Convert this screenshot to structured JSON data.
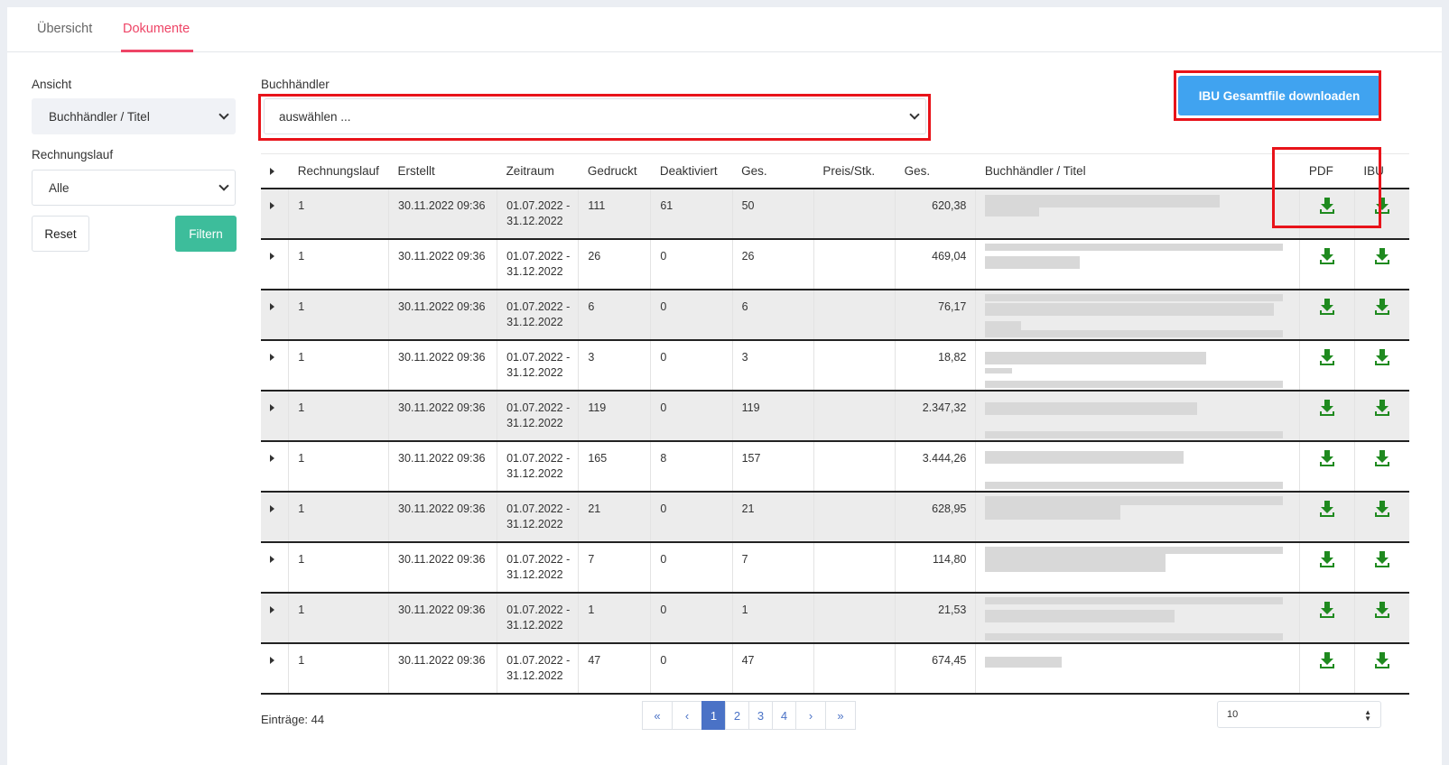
{
  "tabs": [
    {
      "label": "Übersicht"
    },
    {
      "label": "Dokumente"
    }
  ],
  "sidebar": {
    "view_label": "Ansicht",
    "view_value": "Buchhändler / Titel",
    "run_label": "Rechnungslauf",
    "run_value": "Alle",
    "reset_label": "Reset",
    "filter_label": "Filtern"
  },
  "filter": {
    "bookseller_label": "Buchhändler",
    "bookseller_placeholder": "auswählen ..."
  },
  "download_all_label": "IBU Gesamtfile downloaden",
  "table": {
    "headers": [
      "Rechnungslauf",
      "Erstellt",
      "Zeitraum",
      "Gedruckt",
      "Deaktiviert",
      "Ges.",
      "Preis/Stk.",
      "Ges.",
      "Buchhändler / Titel",
      "PDF",
      "IBU"
    ],
    "rows": [
      {
        "run": "1",
        "created": "30.11.2022 09:36",
        "period_from": "01.07.2022 -",
        "period_to": "31.12.2022",
        "printed": "111",
        "deactivated": "61",
        "total": "50",
        "price": "",
        "sum": "620,38"
      },
      {
        "run": "1",
        "created": "30.11.2022 09:36",
        "period_from": "01.07.2022 -",
        "period_to": "31.12.2022",
        "printed": "26",
        "deactivated": "0",
        "total": "26",
        "price": "",
        "sum": "469,04"
      },
      {
        "run": "1",
        "created": "30.11.2022 09:36",
        "period_from": "01.07.2022 -",
        "period_to": "31.12.2022",
        "printed": "6",
        "deactivated": "0",
        "total": "6",
        "price": "",
        "sum": "76,17"
      },
      {
        "run": "1",
        "created": "30.11.2022 09:36",
        "period_from": "01.07.2022 -",
        "period_to": "31.12.2022",
        "printed": "3",
        "deactivated": "0",
        "total": "3",
        "price": "",
        "sum": "18,82"
      },
      {
        "run": "1",
        "created": "30.11.2022 09:36",
        "period_from": "01.07.2022 -",
        "period_to": "31.12.2022",
        "printed": "119",
        "deactivated": "0",
        "total": "119",
        "price": "",
        "sum": "2.347,32"
      },
      {
        "run": "1",
        "created": "30.11.2022 09:36",
        "period_from": "01.07.2022 -",
        "period_to": "31.12.2022",
        "printed": "165",
        "deactivated": "8",
        "total": "157",
        "price": "",
        "sum": "3.444,26"
      },
      {
        "run": "1",
        "created": "30.11.2022 09:36",
        "period_from": "01.07.2022 -",
        "period_to": "31.12.2022",
        "printed": "21",
        "deactivated": "0",
        "total": "21",
        "price": "",
        "sum": "628,95"
      },
      {
        "run": "1",
        "created": "30.11.2022 09:36",
        "period_from": "01.07.2022 -",
        "period_to": "31.12.2022",
        "printed": "7",
        "deactivated": "0",
        "total": "7",
        "price": "",
        "sum": "114,80"
      },
      {
        "run": "1",
        "created": "30.11.2022 09:36",
        "period_from": "01.07.2022 -",
        "period_to": "31.12.2022",
        "printed": "1",
        "deactivated": "0",
        "total": "1",
        "price": "",
        "sum": "21,53"
      },
      {
        "run": "1",
        "created": "30.11.2022 09:36",
        "period_from": "01.07.2022 -",
        "period_to": "31.12.2022",
        "printed": "47",
        "deactivated": "0",
        "total": "47",
        "price": "",
        "sum": "674,45"
      }
    ]
  },
  "entries_label": "Einträge: 44",
  "pagination": {
    "first": "«",
    "prev": "‹",
    "pages": [
      "1",
      "2",
      "3",
      "4"
    ],
    "current": "1",
    "next": "›",
    "last": "»"
  },
  "per_page": "10",
  "icons": {
    "download": "download-tray-icon",
    "expand": "caret-right-icon"
  },
  "colors": {
    "accent": "#ee4466",
    "primary": "#40a3f0",
    "success": "#3dbd9b",
    "download": "#1f8a1f",
    "page_active": "#4a72c6",
    "highlight_box": "#e8131a"
  }
}
